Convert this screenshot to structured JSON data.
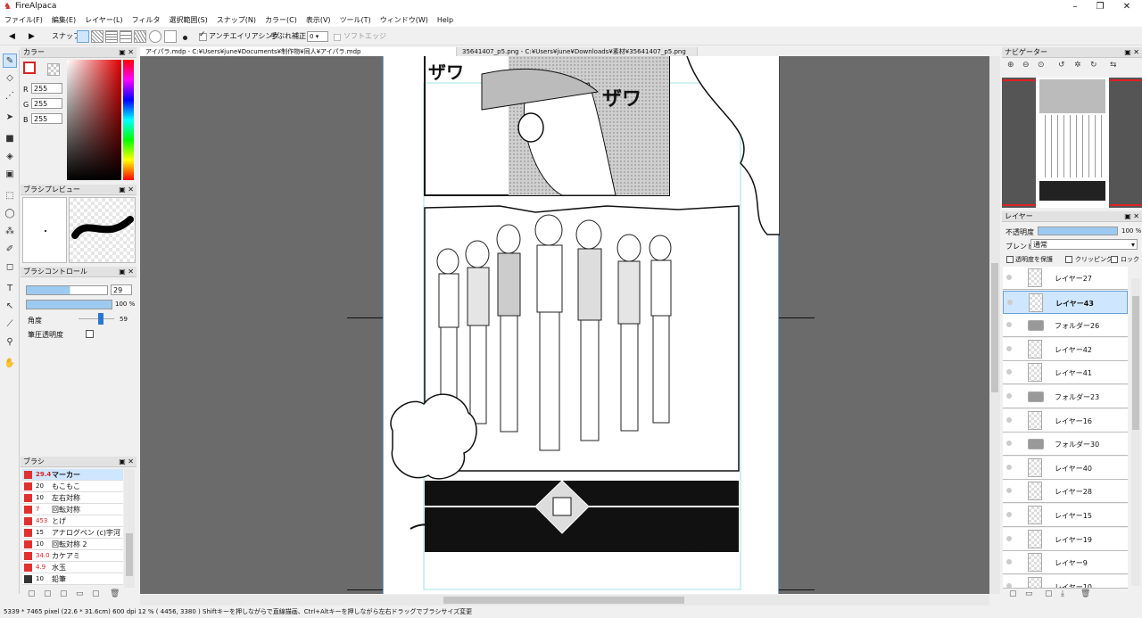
{
  "app": {
    "title": "FireAlpaca",
    "icon": "alpaca-icon"
  },
  "menu": [
    "ファイル(F)",
    "編集(E)",
    "レイヤー(L)",
    "フィルタ",
    "選択範囲(S)",
    "スナップ(N)",
    "カラー(C)",
    "表示(V)",
    "ツール(T)",
    "ウィンドウ(W)",
    "Help"
  ],
  "toolbar": {
    "snap_label": "スナップ",
    "antialias_label": "アンチエイリアシング",
    "stabilizer_label": "手ぶれ補正",
    "stabilizer_value": "0",
    "softedge_label": "ソフトエッジ"
  },
  "color_panel": {
    "title": "カラー",
    "r_label": "R",
    "g_label": "G",
    "b_label": "B",
    "r": "255",
    "g": "255",
    "b": "255",
    "fg_color": "#ffffff",
    "bg_color": "#000000"
  },
  "brush_preview": {
    "title": "ブラシプレビュー"
  },
  "brush_control": {
    "title": "ブラシコントロール",
    "size": "29",
    "opacity": "100 %",
    "angle_label": "角度",
    "angle": "59",
    "pressure_label": "筆圧透明度"
  },
  "brush_panel": {
    "title": "ブラシ",
    "items": [
      {
        "size": "29.4",
        "name": "マーカー",
        "color": "#e03030"
      },
      {
        "size": "20",
        "name": "もこもこ",
        "color": "#e03030"
      },
      {
        "size": "10",
        "name": "左右対称",
        "color": "#e03030"
      },
      {
        "size": "7",
        "name": "回転対称",
        "color": "#e03030"
      },
      {
        "size": "453",
        "name": "とげ",
        "color": "#e03030"
      },
      {
        "size": "15",
        "name": "アナログペン (c)宇河弘樹",
        "color": "#e03030"
      },
      {
        "size": "10",
        "name": "回転対称 2",
        "color": "#e03030"
      },
      {
        "size": "34.0",
        "name": "カケアミ",
        "color": "#e03030"
      },
      {
        "size": "4.9",
        "name": "水玉",
        "color": "#e03030"
      },
      {
        "size": "10",
        "name": "鉛筆",
        "color": "#333333"
      }
    ]
  },
  "doc_tabs": [
    {
      "label": "アイパラ.mdp - C:¥Users¥june¥Documents¥制作物¥同人¥アイパラ.mdp",
      "active": true
    },
    {
      "label": "35641407_p5.png - C:¥Users¥june¥Downloads¥素材¥35641407_p5.png",
      "active": false
    }
  ],
  "navigator": {
    "title": "ナビゲーター"
  },
  "layers": {
    "title": "レイヤー",
    "opacity_label": "不透明度",
    "opacity": "100 %",
    "blend_label": "ブレンド",
    "blend": "通常",
    "protect_label": "透明度を保護",
    "clip_label": "クリッピング",
    "lock_label": "ロック",
    "items": [
      {
        "name": "レイヤー27",
        "type": "layer",
        "selected": false
      },
      {
        "name": "レイヤー43",
        "type": "layer",
        "selected": true
      },
      {
        "name": "フォルダー26",
        "type": "folder",
        "selected": false
      },
      {
        "name": "レイヤー42",
        "type": "layer",
        "selected": false
      },
      {
        "name": "レイヤー41",
        "type": "layer",
        "selected": false
      },
      {
        "name": "フォルダー23",
        "type": "folder",
        "selected": false
      },
      {
        "name": "レイヤー16",
        "type": "layer",
        "selected": false
      },
      {
        "name": "フォルダー30",
        "type": "folder",
        "selected": false
      },
      {
        "name": "レイヤー40",
        "type": "layer",
        "selected": false
      },
      {
        "name": "レイヤー28",
        "type": "layer",
        "selected": false
      },
      {
        "name": "レイヤー15",
        "type": "layer",
        "selected": false
      },
      {
        "name": "レイヤー19",
        "type": "layer",
        "selected": false
      },
      {
        "name": "レイヤー9",
        "type": "layer",
        "selected": false
      },
      {
        "name": "レイヤー10",
        "type": "layer",
        "selected": false
      }
    ]
  },
  "status": {
    "size": "5339 * 7465 pixel",
    "cm": "(22.6 * 31.6cm)",
    "dpi": "600 dpi",
    "zoom": "12 %",
    "coords": "( 4456, 3380 )",
    "hint": "Shiftキーを押しながらで直線描画、Ctrl+Altキーを押しながら左右ドラッグでブラシサイズ変更"
  },
  "canvas": {
    "sfx1": "ザワ",
    "sfx2": "ザワ"
  }
}
